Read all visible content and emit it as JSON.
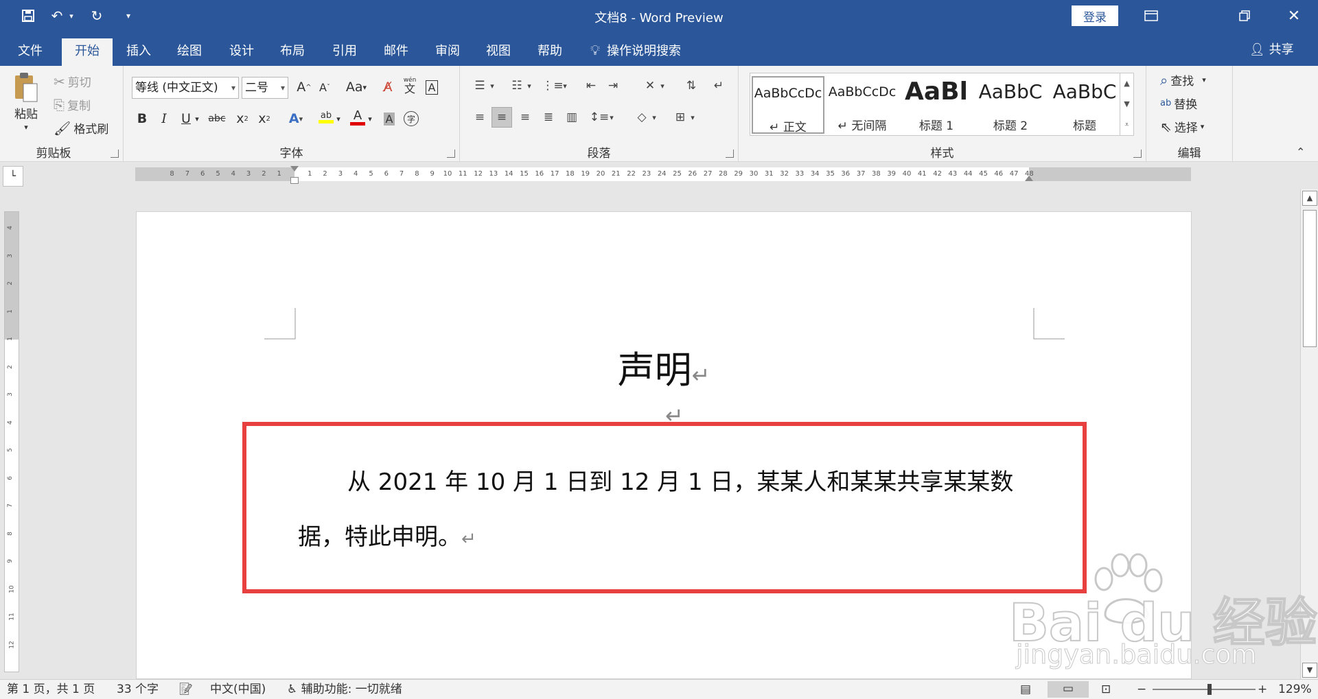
{
  "titlebar": {
    "title": "文档8  -  Word Preview",
    "login_label": "登录",
    "save_icon": "save-icon",
    "undo_icon": "undo-icon",
    "redo_icon": "redo-icon"
  },
  "tabs": [
    {
      "label": "文件",
      "active": false
    },
    {
      "label": "开始",
      "active": true
    },
    {
      "label": "插入",
      "active": false
    },
    {
      "label": "绘图",
      "active": false
    },
    {
      "label": "设计",
      "active": false
    },
    {
      "label": "布局",
      "active": false
    },
    {
      "label": "引用",
      "active": false
    },
    {
      "label": "邮件",
      "active": false
    },
    {
      "label": "审阅",
      "active": false
    },
    {
      "label": "视图",
      "active": false
    },
    {
      "label": "帮助",
      "active": false
    }
  ],
  "tell_me": "操作说明搜索",
  "share_label": "共享",
  "clipboard": {
    "label": "剪贴板",
    "paste": "粘贴",
    "cut": "剪切",
    "copy": "复制",
    "format_painter": "格式刷"
  },
  "font": {
    "label": "字体",
    "font_name": "等线 (中文正文)",
    "font_size": "二号",
    "grow": "A",
    "shrink": "A",
    "change_case": "Aa",
    "bold": "B",
    "italic": "I",
    "underline": "U",
    "strike": "abc",
    "subscript": "x",
    "superscript": "x",
    "phonetic_top": "wén",
    "phonetic_bottom": "文",
    "char_border": "A",
    "char_shading": "A",
    "enclose": "字",
    "highlight": "ab",
    "font_color": "A",
    "text_effects": "A"
  },
  "paragraph": {
    "label": "段落"
  },
  "styles": {
    "label": "样式",
    "items": [
      {
        "sample": "AaBbCcDc",
        "name": "↵ 正文",
        "selected": true
      },
      {
        "sample": "AaBbCcDc",
        "name": "↵ 无间隔",
        "selected": false
      },
      {
        "sample": "AaBl",
        "name": "标题 1",
        "selected": false
      },
      {
        "sample": "AaBbC",
        "name": "标题 2",
        "selected": false
      },
      {
        "sample": "AaBbC",
        "name": "标题",
        "selected": false
      }
    ]
  },
  "editing": {
    "label": "编辑",
    "find": "查找",
    "replace": "替换",
    "select": "选择"
  },
  "ruler": {
    "left_numbers": [
      "8",
      "7",
      "6",
      "5",
      "4",
      "3",
      "2",
      "1"
    ],
    "right_numbers": [
      "1",
      "2",
      "3",
      "4",
      "5",
      "6",
      "7",
      "8",
      "9",
      "10",
      "11",
      "12",
      "13",
      "14",
      "15",
      "16",
      "17",
      "18",
      "19",
      "20",
      "21",
      "22",
      "23",
      "24",
      "25",
      "26",
      "27",
      "28",
      "29",
      "30",
      "31",
      "32",
      "33",
      "34",
      "35",
      "36",
      "37",
      "38",
      "39",
      "40",
      "41",
      "42",
      "43",
      "44",
      "45",
      "46",
      "47",
      "48"
    ]
  },
  "vruler": {
    "numbers": [
      "4",
      "3",
      "2",
      "1",
      "1",
      "2",
      "3",
      "4",
      "5",
      "6",
      "7",
      "8",
      "9",
      "10",
      "11",
      "12"
    ]
  },
  "document": {
    "heading": "声明",
    "body_line1": "从 2021 年 10 月 1 日到 12 月 1 日，某某人和某某共享某某数",
    "body_line2": "据，特此申明。"
  },
  "watermark": {
    "text": "Bai du 经验",
    "url": "jingyan.baidu.com"
  },
  "statusbar": {
    "page": "第 1 页，共 1 页",
    "words": "33 个字",
    "language": "中文(中国)",
    "accessibility": "辅助功能: 一切就绪",
    "zoom": "129%",
    "zoom_minus": "−",
    "zoom_plus": "+"
  },
  "colors": {
    "brand": "#2b579a",
    "highlight_box": "#e8403f",
    "font_color_bar": "#e00000",
    "highlight_bar": "#ffff00"
  }
}
